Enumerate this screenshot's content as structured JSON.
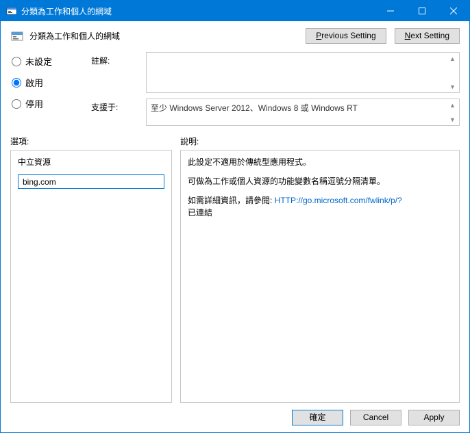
{
  "window": {
    "title": "分類為工作和個人的網域"
  },
  "header": {
    "title": "分類為工作和個人的網域",
    "prev": "Previous Setting",
    "next": "Next Setting",
    "prev_mn": "P",
    "next_mn": "N"
  },
  "radios": {
    "not_configured": "未設定",
    "enabled": "啟用",
    "disabled": "停用"
  },
  "fields": {
    "comment_label": "註解:",
    "comment_value": "",
    "supported_label": "支援于:",
    "supported_value": "至少 Windows Server 2012、Windows 8 或 Windows RT"
  },
  "mid": {
    "options_label": "選項:",
    "help_label": "說明:"
  },
  "options_panel": {
    "heading": "中立資源",
    "value": "bing.com"
  },
  "help_panel": {
    "p1": "此設定不適用於傳統型應用程式。",
    "p2": "可做為工作或個人資源的功能變數名稱逗號分隔清單。",
    "p3_pre": "如需詳細資訊，請參閱: ",
    "p3_link": "HTTP://go.microsoft.com/fwlink/p/?",
    "p3_post": "已連結"
  },
  "footer": {
    "ok": "確定",
    "cancel": "Cancel",
    "apply": "Apply"
  }
}
